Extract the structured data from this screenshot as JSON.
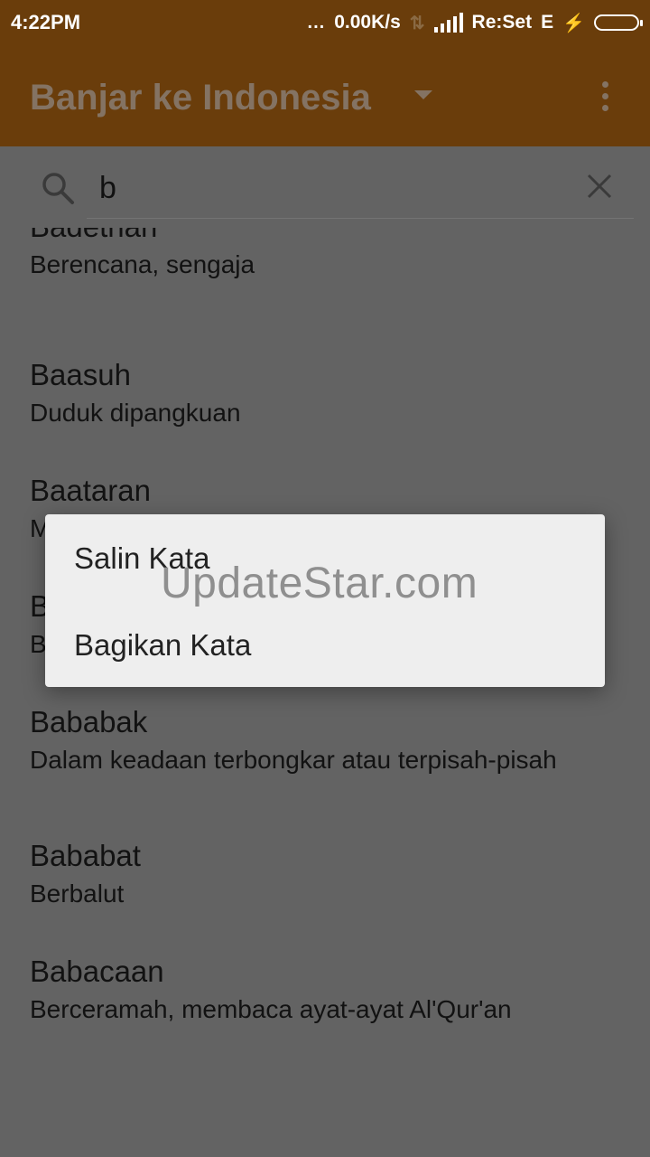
{
  "status_bar": {
    "time": "4:22PM",
    "dots": "...",
    "network_speed": "0.00K/s",
    "carrier": "Re:Set",
    "network_type": "E"
  },
  "app_bar": {
    "title": "Banjar ke Indonesia"
  },
  "search": {
    "value": "b"
  },
  "list": {
    "items": [
      {
        "word": "Badethan",
        "meaning": "Berencana, sengaja"
      },
      {
        "word": "Baasuh",
        "meaning": "Duduk dipangkuan"
      },
      {
        "word": "Baataran",
        "meaning": "M"
      },
      {
        "word": "B",
        "meaning": "B"
      },
      {
        "word": "Bababak",
        "meaning": "Dalam keadaan terbongkar atau terpisah-pisah"
      },
      {
        "word": "Bababat",
        "meaning": "Berbalut"
      },
      {
        "word": "Babacaan",
        "meaning": "Berceramah, membaca ayat-ayat Al'Qur'an"
      }
    ]
  },
  "context_menu": {
    "copy_label": "Salin Kata",
    "share_label": "Bagikan Kata"
  },
  "watermark": "UpdateStar.com",
  "colors": {
    "app_bar": "#6a3d0b",
    "scrim_background": "#636363",
    "dialog": "#eeeeee",
    "battery": "#6cc51a"
  }
}
